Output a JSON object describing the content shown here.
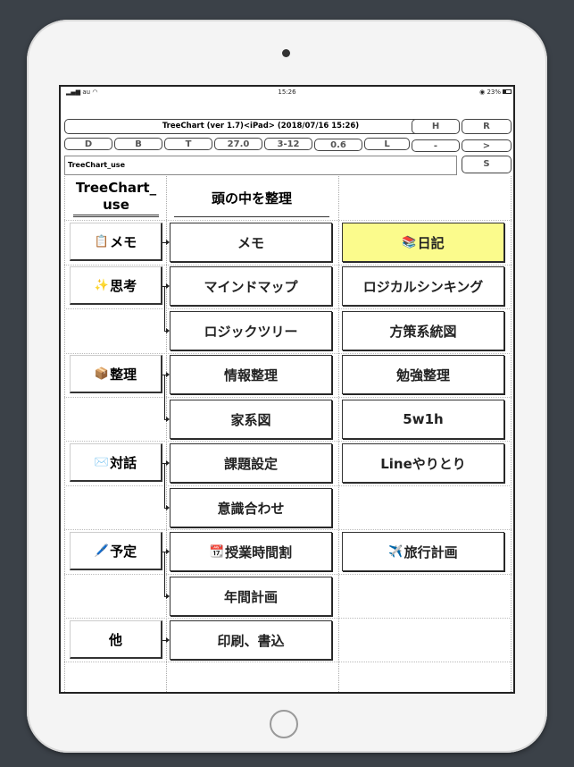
{
  "status_bar": {
    "carrier": "au",
    "time": "15:26",
    "battery": "23%"
  },
  "title_bar": {
    "title": "TreeChart (ver 1.7)<iPad> (2018/07/16 15:26)",
    "h_label": "H",
    "r_label": "R"
  },
  "param_bar": {
    "d": "D",
    "b": "B",
    "t": "T",
    "size": "27.0",
    "range": "3-12",
    "ratio": "0.6",
    "l": "L",
    "minus": "-",
    "next": ">"
  },
  "name_bar": {
    "value": "TreeChart_use",
    "s_label": "S"
  },
  "tree": {
    "root_title": "TreeChart_\nuse",
    "root_title_line1": "TreeChart_",
    "root_title_line2": "use",
    "root_topic": "頭の中を整理",
    "categories": [
      {
        "icon": "📋",
        "label": "メモ"
      },
      {
        "icon": "✨",
        "label": "思考"
      },
      {
        "icon": "📦",
        "label": "整理"
      },
      {
        "icon": "✉️",
        "label": "対話"
      },
      {
        "icon": "🖊️",
        "label": "予定"
      },
      {
        "icon": "",
        "label": "他"
      }
    ],
    "nodes": {
      "memo": "メモ",
      "diary": "日記",
      "diary_icon": "📚",
      "mindmap": "マインドマップ",
      "logical": "ロジカルシンキング",
      "logictree": "ロジックツリー",
      "policy": "方策系統図",
      "info": "情報整理",
      "study": "勉強整理",
      "family": "家系図",
      "w5h1": "5w1h",
      "issue": "課題設定",
      "line": "Lineやりとり",
      "align": "意識合わせ",
      "timetable": "授業時間割",
      "timetable_icon": "📆",
      "travel": "旅行計画",
      "travel_icon": "✈️",
      "yearly": "年間計画",
      "print": "印刷、書込"
    }
  }
}
